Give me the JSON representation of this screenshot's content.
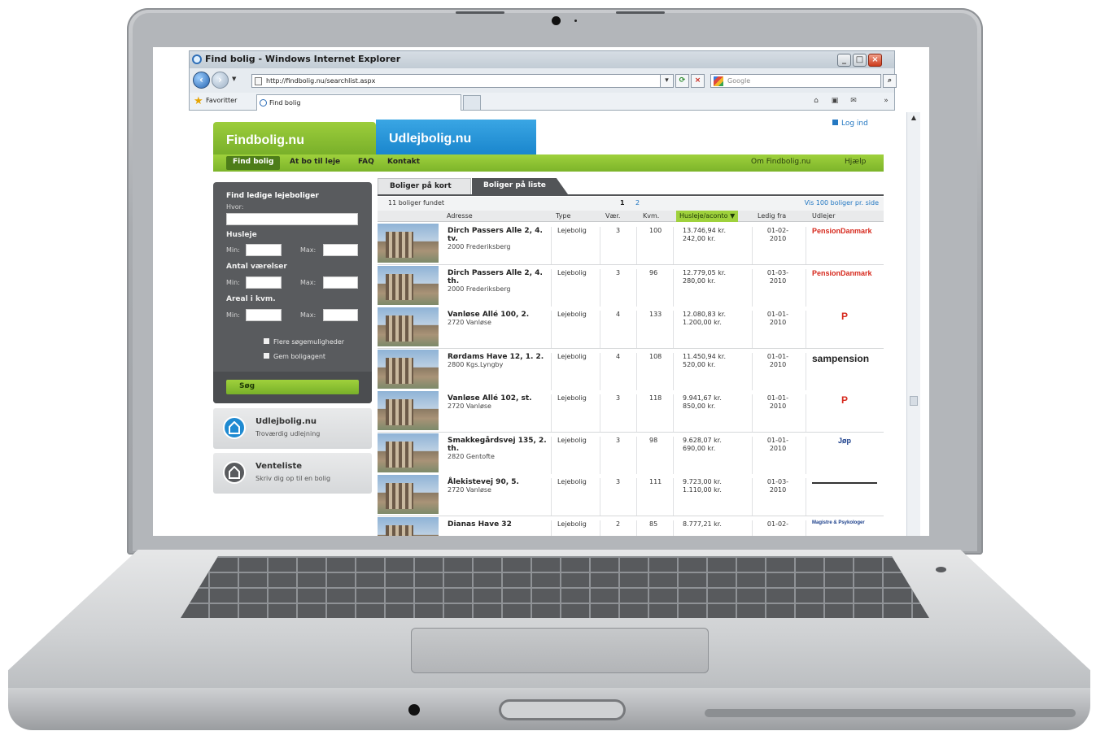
{
  "browser": {
    "window_title": "Find bolig - Windows Internet Explorer",
    "address": "http://findbolig.nu/searchlist.aspx",
    "search_placeholder": "Google",
    "favorites_label": "Favoritter",
    "tab_title": "Find bolig"
  },
  "site": {
    "logo_findbolig": "Findbolig.nu",
    "logo_udlejbolig": "Udlejbolig.nu",
    "login": "Log ind",
    "nav": [
      "Find bolig",
      "At bo til leje",
      "FAQ",
      "Kontakt"
    ],
    "nav_right": [
      "Om Findbolig.nu",
      "Hjælp"
    ]
  },
  "search": {
    "heading": "Find ledige lejeboliger",
    "where_label": "Hvor:",
    "rent_label": "Husleje",
    "rooms_label": "Antal værelser",
    "area_label": "Areal i kvm.",
    "min_label": "Min:",
    "max_label": "Max:",
    "more_options": "Flere søgemuligheder",
    "save_agent": "Gem boligagent",
    "submit": "Søg"
  },
  "promos": [
    {
      "title": "Udlejbolig.nu",
      "subtitle": "Troværdig udlejning"
    },
    {
      "title": "Venteliste",
      "subtitle": "Skriv dig op til en bolig"
    }
  ],
  "results": {
    "tabs": [
      "Boliger på kort",
      "Boliger på liste"
    ],
    "count": "11 boliger fundet",
    "pages": [
      "1",
      "2"
    ],
    "per_page": "Vis 100 boliger pr. side",
    "columns": [
      "Adresse",
      "Type",
      "Vær.",
      "Kvm.",
      "Husleje/aconto",
      "Ledig fra",
      "Udlejer"
    ],
    "rows": [
      {
        "street": "Dirch Passers Alle 2, 4. tv.",
        "city": "2000 Frederiksberg",
        "type": "Lejebolig",
        "rooms": "3",
        "sqm": "100",
        "rent": "13.746,94 kr.",
        "aconto": "242,00 kr.",
        "from": "01-02-2010",
        "landlord": "PensionDanmark"
      },
      {
        "street": "Dirch Passers Alle 2, 4. th.",
        "city": "2000 Frederiksberg",
        "type": "Lejebolig",
        "rooms": "3",
        "sqm": "96",
        "rent": "12.779,05 kr.",
        "aconto": "280,00 kr.",
        "from": "01-03-2010",
        "landlord": "PensionDanmark"
      },
      {
        "street": "Vanløse Allé 100, 2.",
        "city": "2720 Vanløse",
        "type": "Lejebolig",
        "rooms": "4",
        "sqm": "133",
        "rent": "12.080,83 kr.",
        "aconto": "1.200,00 kr.",
        "from": "01-01-2010",
        "landlord": "P"
      },
      {
        "street": "Rørdams Have 12, 1. 2.",
        "city": "2800 Kgs.Lyngby",
        "type": "Lejebolig",
        "rooms": "4",
        "sqm": "108",
        "rent": "11.450,94 kr.",
        "aconto": "520,00 kr.",
        "from": "01-01-2010",
        "landlord": "sampension"
      },
      {
        "street": "Vanløse Allé 102, st.",
        "city": "2720 Vanløse",
        "type": "Lejebolig",
        "rooms": "3",
        "sqm": "118",
        "rent": "9.941,67 kr.",
        "aconto": "850,00 kr.",
        "from": "01-01-2010",
        "landlord": "P"
      },
      {
        "street": "Smakkegårdsvej 135, 2. th.",
        "city": "2820 Gentofte",
        "type": "Lejebolig",
        "rooms": "3",
        "sqm": "98",
        "rent": "9.628,07 kr.",
        "aconto": "690,00 kr.",
        "from": "01-01-2010",
        "landlord": "Jøp"
      },
      {
        "street": "Ålekistevej 90, 5.",
        "city": "2720 Vanløse",
        "type": "Lejebolig",
        "rooms": "3",
        "sqm": "111",
        "rent": "9.723,00 kr.",
        "aconto": "1.110,00 kr.",
        "from": "01-03-2010",
        "landlord": ""
      },
      {
        "street": "Dianas Have 32",
        "city": "",
        "type": "Lejebolig",
        "rooms": "2",
        "sqm": "85",
        "rent": "8.777,21 kr.",
        "aconto": "",
        "from": "01-02-",
        "landlord": "Magistre & Psykologer"
      }
    ]
  },
  "colors": {
    "green": "#8cc432",
    "blue": "#2491d6",
    "sidebar": "#595b5e",
    "pensiondanmark": "#d6281c"
  }
}
